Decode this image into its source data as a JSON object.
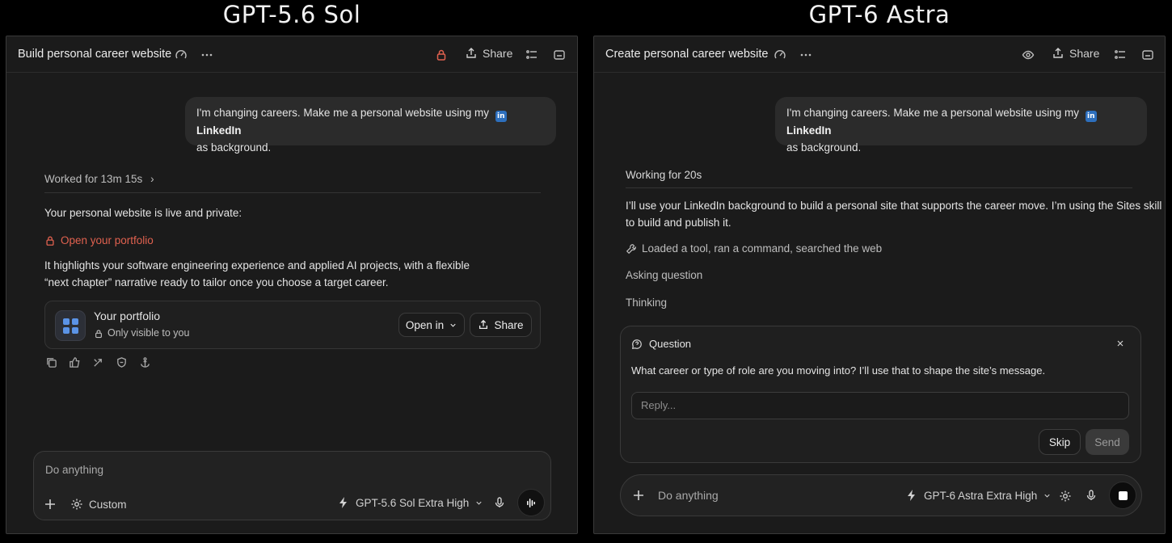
{
  "captions": {
    "left": "GPT-5.6 Sol",
    "right": "GPT-6 Astra"
  },
  "left": {
    "title": "Build personal career website",
    "share_label": "Share",
    "user_message": {
      "before": "I'm changing careers. Make me a personal website using my",
      "linkedin_badge": "in",
      "linkedin_label": "LinkedIn",
      "after": "as background."
    },
    "worked_for": "Worked for 13m 15s",
    "status_line": "Your personal website is live and private:",
    "portfolio_link": "Open your portfolio",
    "summary_line1": "It highlights your software engineering experience and applied AI projects, with a flexible",
    "summary_line2": "“next chapter” narrative ready to tailor once you choose a target career.",
    "card": {
      "title": "Your portfolio",
      "subtitle": "Only visible to you",
      "open_in_label": "Open in",
      "share_label": "Share"
    },
    "composer": {
      "placeholder": "Do anything",
      "custom_label": "Custom",
      "model_label": "GPT-5.6 Sol Extra High"
    },
    "accent_color": "#e0614f"
  },
  "right": {
    "title": "Create personal career website",
    "share_label": "Share",
    "user_message": {
      "before": "I'm changing careers. Make me a personal website using my",
      "linkedin_badge": "in",
      "linkedin_label": "LinkedIn",
      "after": "as background."
    },
    "working_for": "Working for 20s",
    "reply_line1": "I’ll use your LinkedIn background to build a personal site that supports the career move. I’m using the Sites skill",
    "reply_line2": "to build and publish it.",
    "tool_summary": "Loaded a tool, ran a command, searched the web",
    "asking": "Asking question",
    "thinking": "Thinking",
    "question": {
      "header": "Question",
      "text": "What career or type of role are you moving into? I’ll use that to shape the site’s message.",
      "reply_placeholder": "Reply...",
      "skip_label": "Skip",
      "send_label": "Send"
    },
    "composer": {
      "placeholder": "Do anything",
      "model_label": "GPT-6 Astra Extra High"
    }
  }
}
